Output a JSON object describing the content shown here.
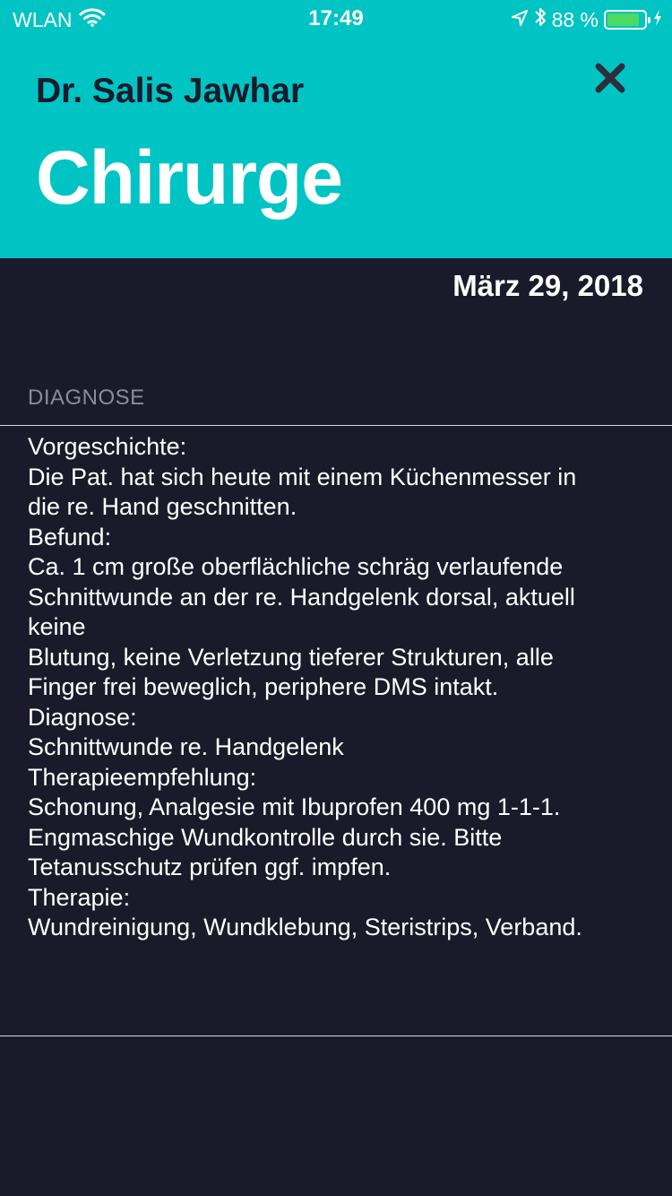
{
  "status_bar": {
    "carrier": "WLAN",
    "time": "17:49",
    "battery_percent": "88 %",
    "battery_level": 0.88,
    "icons": [
      "wifi-icon",
      "location-arrow-icon",
      "bluetooth-icon",
      "battery-icon",
      "charging-bolt-icon"
    ]
  },
  "header": {
    "doctor_name": "Dr. Salis Jawhar",
    "specialty": "Chirurge",
    "close_icon": "close-icon",
    "background_color": "#00c4c4"
  },
  "record": {
    "date": "März 29, 2018",
    "section_label": "DIAGNOSE",
    "lines": [
      "Vorgeschichte:",
      "Die Pat. hat sich heute mit einem Küchenmesser in",
      "die re. Hand geschnitten.",
      "Befund:",
      "Ca. 1 cm große oberflächliche schräg verlaufende",
      "Schnittwunde an der re. Handgelenk dorsal, aktuell",
      "keine",
      "Blutung, keine Verletzung tieferer Strukturen, alle",
      "Finger frei beweglich, periphere DMS intakt.",
      "Diagnose:",
      "Schnittwunde re. Handgelenk",
      "Therapieempfehlung:",
      "Schonung, Analgesie mit Ibuprofen 400 mg 1-1-1.",
      "Engmaschige Wundkontrolle durch sie. Bitte",
      "Tetanusschutz prüfen ggf. impfen.",
      "Therapie:",
      "Wundreinigung, Wundklebung, Steristrips, Verband."
    ]
  }
}
